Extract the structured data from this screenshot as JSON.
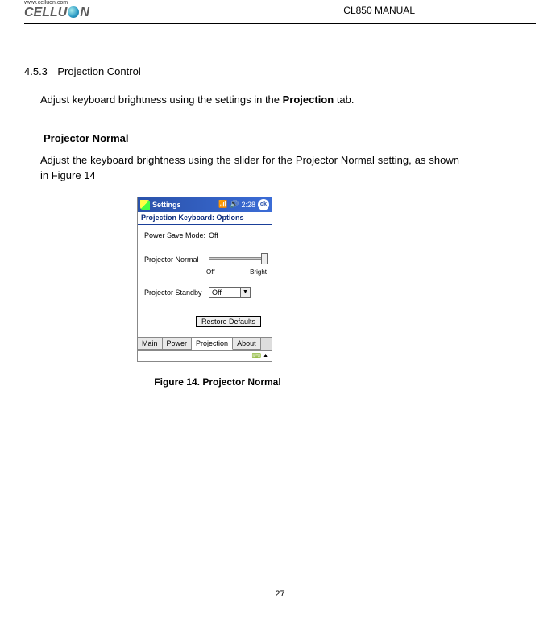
{
  "header": {
    "logo_url": "www.celluon.com",
    "logo_text_left": "CELLU",
    "logo_text_right": "N",
    "manual_title": "CL850 MANUAL"
  },
  "section": {
    "number": "4.5.3",
    "title": "Projection Control",
    "intro_1": "Adjust keyboard brightness using the settings in the ",
    "intro_bold": "Projection",
    "intro_2": " tab."
  },
  "sub": {
    "heading": "Projector Normal",
    "para": "Adjust the keyboard brightness using the slider for the Projector Normal setting, as shown in Figure 14"
  },
  "screenshot": {
    "start_label": "Settings",
    "time": "2:28",
    "ok": "ok",
    "subtitle": "Projection Keyboard: Options",
    "power_save_label": "Power Save Mode:",
    "power_save_value": "Off",
    "projector_normal_label": "Projector Normal",
    "slider_min": "Off",
    "slider_max": "Bright",
    "projector_standby_label": "Projector Standby",
    "projector_standby_value": "Off",
    "restore_button": "Restore Defaults",
    "tabs": {
      "main": "Main",
      "power": "Power",
      "projection": "Projection",
      "about": "About"
    }
  },
  "figure_caption": "Figure 14. Projector Normal",
  "page_number": "27"
}
